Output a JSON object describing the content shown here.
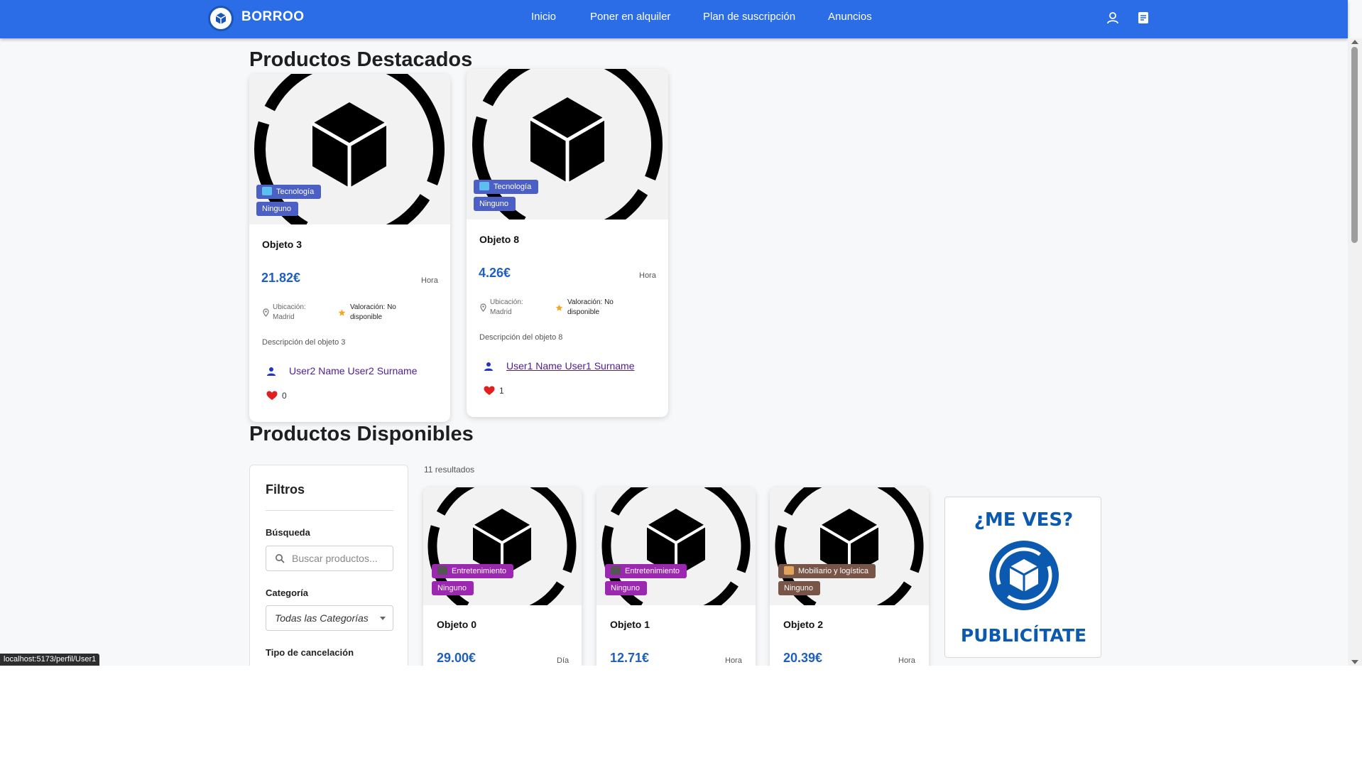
{
  "navbar": {
    "brand": "BORROO",
    "links": [
      "Inicio",
      "Poner en alquiler",
      "Plan de suscripción",
      "Anuncios"
    ],
    "icons": [
      "user-icon",
      "document-icon"
    ],
    "color": "#2b6de6"
  },
  "featured": {
    "title": "Productos Destacados",
    "cards": [
      {
        "category": "Tecnología",
        "cancellation": "Ninguno",
        "name": "Objeto 3",
        "price": "21.82€",
        "unit": "Hora",
        "location": "Ubicación: Madrid",
        "rating": "Valoración: No disponible",
        "description": "Descripción del objeto 3",
        "user": "User2 Name User2 Surname",
        "likes": "0"
      },
      {
        "category": "Tecnología",
        "cancellation": "Ninguno",
        "name": "Objeto 8",
        "price": "4.26€",
        "unit": "Hora",
        "location": "Ubicación: Madrid",
        "rating": "Valoración: No disponible",
        "description": "Descripción del objeto 8",
        "user": "User1 Name User1 Surname",
        "likes": "1"
      }
    ]
  },
  "available": {
    "title": "Productos Disponibles",
    "results": "11 resultados",
    "filters": {
      "heading": "Filtros",
      "search_label": "Búsqueda",
      "search_placeholder": "Buscar productos...",
      "category_label": "Categoría",
      "category_value": "Todas las Categorías",
      "cancel_label": "Tipo de cancelación"
    },
    "cards": [
      {
        "category": "Entretenimiento",
        "cancellation": "Ninguno",
        "name": "Objeto 0",
        "price": "29.00€",
        "unit": "Día"
      },
      {
        "category": "Entretenimiento",
        "cancellation": "Ninguno",
        "name": "Objeto 1",
        "price": "12.71€",
        "unit": "Hora"
      },
      {
        "category": "Mobiliario y logística",
        "cancellation": "Ninguno",
        "name": "Objeto 2",
        "price": "20.39€",
        "unit": "Hora"
      }
    ],
    "ad": {
      "top": "¿ME VES?",
      "bottom": "PUBLICÍTATE"
    }
  },
  "colors": {
    "tech_badge": "#4b5fc4",
    "entertainment_badge": "#9c27b0",
    "furniture_badge": "#795548",
    "price": "#1f5fbf",
    "user_link": "#4d1d96"
  },
  "status_url": "localhost:5173/perfil/User1"
}
